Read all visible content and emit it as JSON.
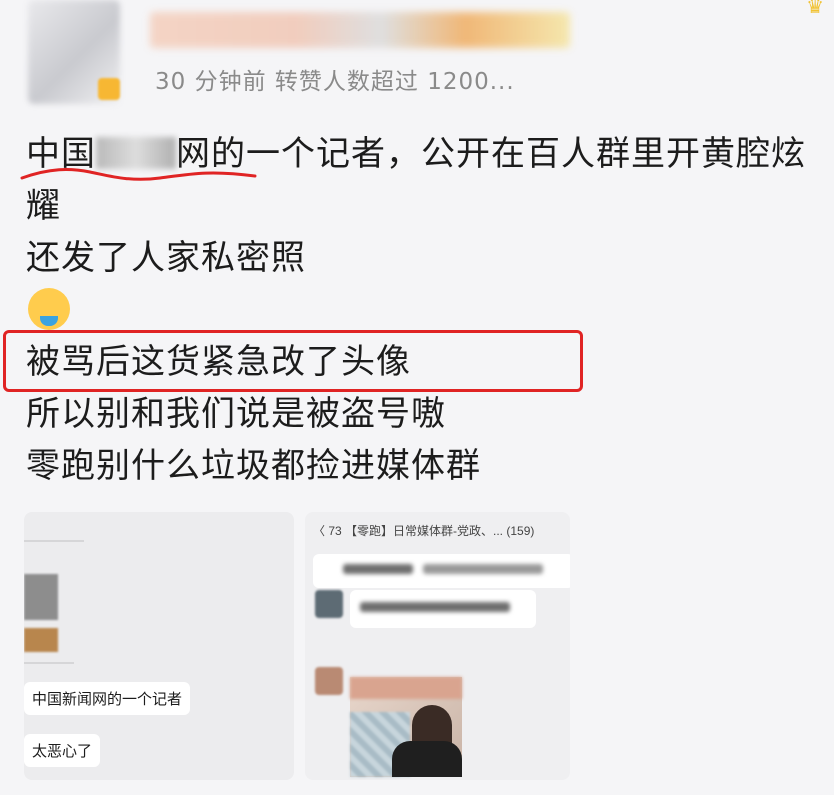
{
  "header": {
    "meta": "30 分钟前 转赞人数超过 1200..."
  },
  "post": {
    "line1_prefix": "中国",
    "line1_suffix": "网的一个记者，公开在百人群里开黄腔炫",
    "line2": "耀",
    "line3": "还发了人家私密照",
    "line5": "被骂后这货紧急改了头像",
    "line6": "所以别和我们说是被盗号嗷",
    "line7": "零跑别什么垃圾都捡进媒体群"
  },
  "screenshot_left": {
    "bubble1": "中国新闻网的一个记者",
    "bubble2": "太恶心了"
  },
  "screenshot_right": {
    "chat_title": "〈 73  【零跑】日常媒体群-党政、... (159)"
  },
  "colors": {
    "highlight_red": "#e02424",
    "meta_gray": "#8a8a8a"
  }
}
